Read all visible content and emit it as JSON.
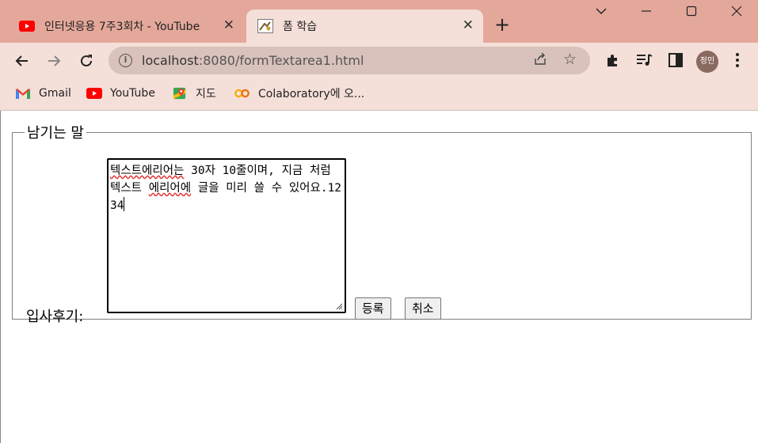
{
  "browser": {
    "tabs": [
      {
        "title": "인터넷응용 7주3회차 - YouTube",
        "favicon": "youtube-icon",
        "active": false
      },
      {
        "title": "폼 학습",
        "favicon": "page-favicon-icon",
        "active": true
      }
    ],
    "url_host": "localhost",
    "url_rest": ":8080/formTextarea1.html",
    "profile_initials": "정민",
    "bookmarks": [
      {
        "label": "Gmail",
        "icon": "gmail-icon"
      },
      {
        "label": "YouTube",
        "icon": "youtube-icon"
      },
      {
        "label": "지도",
        "icon": "maps-icon"
      },
      {
        "label": "Colaboratory에 오...",
        "icon": "colab-icon"
      }
    ]
  },
  "form": {
    "legend": "남기는 말",
    "label": "입사후기:",
    "textarea_value_pre": "텍스트에리어는",
    "textarea_value_mid1": " 30자 10줄이며, 지금 처럼 텍스트 ",
    "textarea_value_spell2": "에리어에",
    "textarea_value_mid2": " 글을 미리 쓸 수 있어요.1234",
    "submit_label": "등록",
    "reset_label": "취소"
  },
  "colors": {
    "tabstrip": "#e4a89b",
    "toolbar": "#f5dfd9",
    "omnibox": "#d9c2bb"
  }
}
